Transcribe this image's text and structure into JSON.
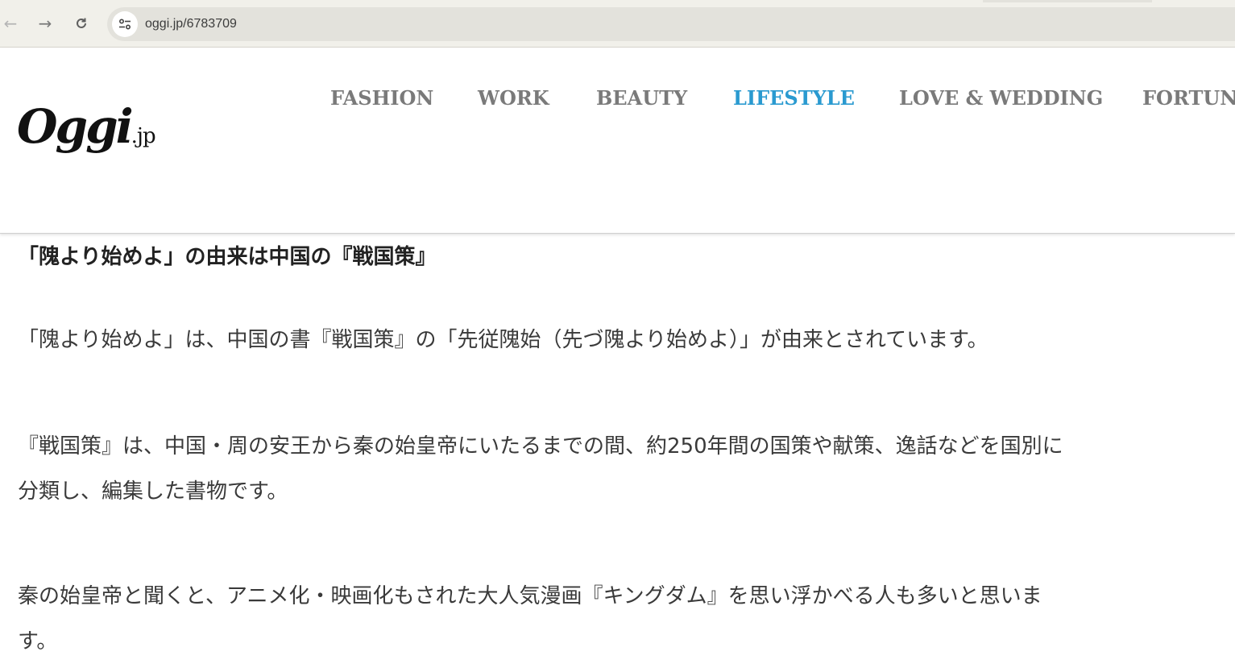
{
  "browser": {
    "url": "oggi.jp/6783709",
    "back_icon": "arrow-left-icon",
    "forward_icon": "arrow-right-icon",
    "reload_icon": "reload-icon",
    "site_info_icon": "tune-icon"
  },
  "logo": {
    "main": "Oggi",
    "suffix": ".jp"
  },
  "nav": {
    "items": [
      {
        "label": "FASHION"
      },
      {
        "label": "WORK"
      },
      {
        "label": "BEAUTY"
      },
      {
        "label": "LIFESTYLE",
        "active": true
      },
      {
        "label": "LOVE & WEDDING"
      },
      {
        "label": "FORTUNI"
      }
    ],
    "active_color": "#2a9ad0",
    "inactive_color": "#7a7a7a"
  },
  "article": {
    "heading": "「隗より始めよ」の由来は中国の『戦国策』",
    "paragraphs": [
      [
        "「隗より始めよ」は、中国の書『戦国策』の「先従隗始（先づ隗より始めよ）」が由来とされています。"
      ],
      [
        "『戦国策』は、中国・周の安王から秦の始皇帝にいたるまでの間、約250年間の国策や献策、逸話などを国別に",
        "分類し、編集した書物です。"
      ],
      [
        "秦の始皇帝と聞くと、アニメ化・映画化もされた大人気漫画『キングダム』を思い浮かべる人も多いと思いま",
        "す。"
      ]
    ]
  }
}
